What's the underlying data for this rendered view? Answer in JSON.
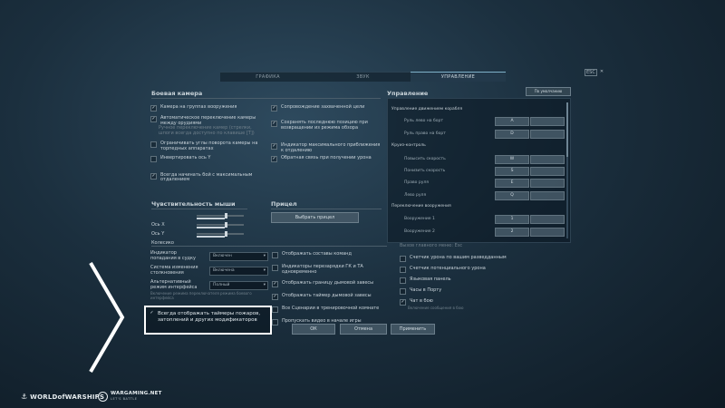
{
  "tabs": [
    "ГРАФИКА",
    "ЗВУК",
    "УПРАВЛЕНИЕ"
  ],
  "close_label": "ESC",
  "camera": {
    "title": "Боевая камера",
    "left": [
      {
        "label": "Камера на группах вооружения",
        "checked": true
      },
      {
        "label": "Автоматическое переключение камеры между орудиями",
        "checked": true
      },
      {
        "label": "Ручное переключение камер (стрелки, шпоги всегда доступно по клавише [T])",
        "checked": false,
        "dim": true
      },
      {
        "label": "Ограничивать углы поворота камеры на торпедных аппаратах",
        "checked": false
      },
      {
        "label": "Инвертировать ось Y",
        "checked": false
      },
      {
        "label": "Всегда начинать бой с максимальным отдалением",
        "checked": true
      }
    ],
    "right": [
      {
        "label": "Сопровождение захваченной цели",
        "checked": true
      },
      {
        "label": "Сохранять последнюю позицию при возвращении из режима обзора",
        "checked": true
      },
      {
        "label": "Индикатор максимального приближения к отдалению",
        "checked": true
      },
      {
        "label": "Обратная связь при получении урона",
        "checked": true
      }
    ]
  },
  "sensitivity": {
    "title": "Чувствительность мыши",
    "axes": [
      {
        "label": "Ось X",
        "value": 0.6
      },
      {
        "label": "Ось Y",
        "value": 0.6
      },
      {
        "label": "Колесико",
        "value": 0.6
      }
    ]
  },
  "sight": {
    "title": "Прицел",
    "button": "Выбрать прицел"
  },
  "bottom_left": [
    {
      "label": "Индикатор попадания в судку",
      "value": "Включен"
    },
    {
      "label": "Система изменения столкновения",
      "value": "Включена"
    },
    {
      "label": "Альтернативный режим интерфейса",
      "value": "Полный"
    }
  ],
  "bottom_left_note": "Включение режима переключателя режима боевого интерфейса",
  "highlight_text": "Всегда отображать таймеры пожаров, затоплений и других модификаторов",
  "bottom_mid": [
    {
      "label": "Отображать составы команд",
      "checked": false
    },
    {
      "label": "Индикаторы перезарядки ГК и ТА одновременно",
      "checked": false
    },
    {
      "label": "Отображать границу дымовой завесы",
      "checked": true
    },
    {
      "label": "Отображать таймер дымовой завесы",
      "checked": true
    },
    {
      "label": "Все Сценарии в тренировочной комнате",
      "checked": false
    },
    {
      "label": "Пропускать видео в начале игры",
      "checked": false
    }
  ],
  "bottom_right_title": "Вызов главного меню: Esc",
  "bottom_right": [
    {
      "label": "Счетчик урона по вашим разведданным",
      "checked": false
    },
    {
      "label": "Счетчик потенциального урона",
      "checked": false
    },
    {
      "label": "Языковая панель",
      "checked": false
    },
    {
      "label": "Часы в Порту",
      "checked": false
    },
    {
      "label": "Чат в бою",
      "checked": true
    }
  ],
  "bottom_right_note": "Включение сообщения в бою",
  "control": {
    "title": "Управление",
    "reset": "По умолчанию",
    "groups": [
      {
        "title": "Управление движением корабля",
        "rows": [
          {
            "label": "Руль лево на борт",
            "key": "A"
          },
          {
            "label": "Руль право на борт",
            "key": "D"
          }
        ]
      },
      {
        "title": "Круиз-контроль",
        "rows": [
          {
            "label": "Повысить скорость",
            "key": "W"
          },
          {
            "label": "Понизить скорость",
            "key": "S"
          },
          {
            "label": "Право руля",
            "key": "E"
          },
          {
            "label": "Лево руля",
            "key": "Q"
          }
        ]
      },
      {
        "title": "Переключение вооружения",
        "rows": [
          {
            "label": "Вооружение 1",
            "key": "1"
          },
          {
            "label": "Вооружение 2",
            "key": "2"
          }
        ]
      }
    ]
  },
  "buttons": {
    "ok": "ОК",
    "cancel": "Отмена",
    "apply": "Применить"
  },
  "logos": {
    "wows": "WORLDofWARSHIPS",
    "wg": "WARGAMING.NET",
    "wg_sub": "LET'S BATTLE"
  }
}
